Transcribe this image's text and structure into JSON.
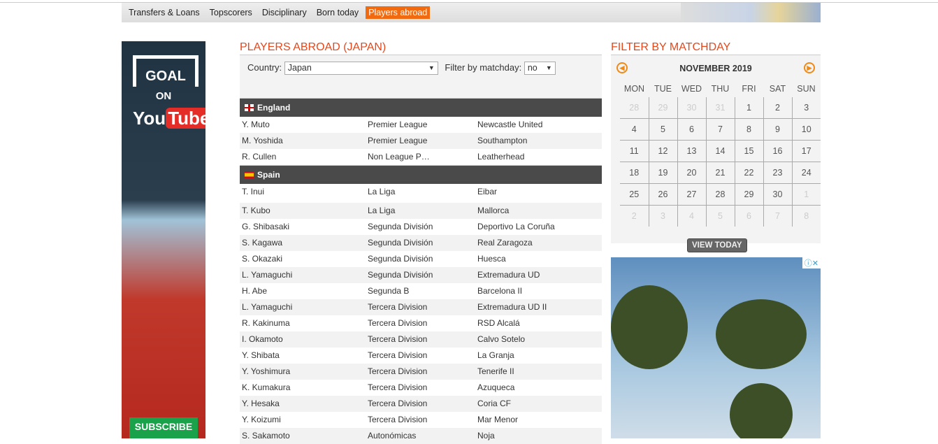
{
  "nav": {
    "items": [
      "Transfers & Loans",
      "Topscorers",
      "Disciplinary",
      "Born today",
      "Players abroad"
    ],
    "active": 4
  },
  "ad_left": {
    "goal": "GOAL",
    "on": "ON",
    "you": "You",
    "tube": "Tube",
    "subscribe": "SUBSCRIBE NOW"
  },
  "main": {
    "title": "PLAYERS ABROAD (JAPAN)",
    "country_label": "Country:",
    "country_value": "Japan",
    "matchday_label": "Filter by matchday:",
    "matchday_value": "no",
    "groups": [
      {
        "country": "England",
        "flag": "england",
        "players": [
          [
            "Y. Muto",
            "Premier League",
            "Newcastle United"
          ],
          [
            "M. Yoshida",
            "Premier League",
            "Southampton"
          ],
          [
            "R. Cullen",
            "Non League P…",
            "Leatherhead"
          ]
        ]
      },
      {
        "country": "Spain",
        "flag": "spain",
        "players": [
          [
            "T. Inui",
            "La Liga",
            "Eibar"
          ],
          [
            "T. Kubo",
            "La Liga",
            "Mallorca"
          ],
          [
            "G. Shibasaki",
            "Segunda División",
            "Deportivo La Coruña"
          ],
          [
            "S. Kagawa",
            "Segunda División",
            "Real Zaragoza"
          ],
          [
            "S. Okazaki",
            "Segunda División",
            "Huesca"
          ],
          [
            "L. Yamaguchi",
            "Segunda División",
            "Extremadura UD"
          ],
          [
            "H. Abe",
            "Segunda B",
            "Barcelona II"
          ],
          [
            "L. Yamaguchi",
            "Tercera Division",
            "Extremadura UD II"
          ],
          [
            "R. Kakinuma",
            "Tercera Division",
            "RSD Alcalá"
          ],
          [
            "I. Okamoto",
            "Tercera Division",
            "Calvo Sotelo"
          ],
          [
            "Y. Shibata",
            "Tercera Division",
            "La Granja"
          ],
          [
            "Y. Yoshimura",
            "Tercera Division",
            "Tenerife II"
          ],
          [
            "K. Kumakura",
            "Tercera Division",
            "Azuqueca"
          ],
          [
            "Y. Hesaka",
            "Tercera Division",
            "Coria CF"
          ],
          [
            "Y. Koizumi",
            "Tercera Division",
            "Mar Menor"
          ],
          [
            "S. Sakamoto",
            "Autonómicas",
            "Noja"
          ]
        ]
      }
    ]
  },
  "calendar": {
    "title": "FILTER BY MATCHDAY",
    "month": "NOVEMBER 2019",
    "days": [
      "MON",
      "TUE",
      "WED",
      "THU",
      "FRI",
      "SAT",
      "SUN"
    ],
    "weeks": [
      [
        "28",
        "29",
        "30",
        "31",
        "1",
        "2",
        "3"
      ],
      [
        "4",
        "5",
        "6",
        "7",
        "8",
        "9",
        "10"
      ],
      [
        "11",
        "12",
        "13",
        "14",
        "15",
        "16",
        "17"
      ],
      [
        "18",
        "19",
        "20",
        "21",
        "22",
        "23",
        "24"
      ],
      [
        "25",
        "26",
        "27",
        "28",
        "29",
        "30",
        "1"
      ],
      [
        "2",
        "3",
        "4",
        "5",
        "6",
        "7",
        "8"
      ]
    ],
    "view_today": "VIEW TODAY"
  },
  "colors": {
    "accent": "#f26a0f",
    "title": "#e8471a"
  }
}
